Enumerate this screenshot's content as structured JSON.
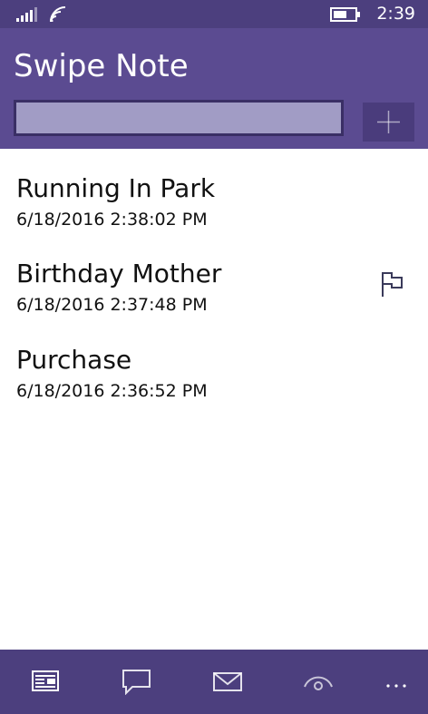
{
  "status_bar": {
    "time": "2:39",
    "icons": [
      "signal-icon",
      "wifi-icon",
      "battery-icon"
    ]
  },
  "header": {
    "title": "Swipe Note",
    "input": {
      "value": "",
      "placeholder": ""
    },
    "add_icon": "plus-icon"
  },
  "notes": [
    {
      "title": "Running In Park",
      "date": "6/18/2016 2:38:02 PM",
      "flagged": false
    },
    {
      "title": "Birthday Mother",
      "date": "6/18/2016 2:37:48 PM",
      "flagged": true
    },
    {
      "title": "Purchase",
      "date": "6/18/2016 2:36:52 PM",
      "flagged": false
    }
  ],
  "app_bar": {
    "icons": [
      "notes-icon",
      "chat-icon",
      "mail-icon",
      "eye-icon",
      "more-icon"
    ]
  },
  "colors": {
    "status_bar": "#4c3f7e",
    "header": "#5b4b91",
    "input_fill": "#a19cc5",
    "input_border": "#3a2f65",
    "add_button": "#4a3c7c",
    "app_bar": "#4c3f7e",
    "text": "#111111"
  }
}
